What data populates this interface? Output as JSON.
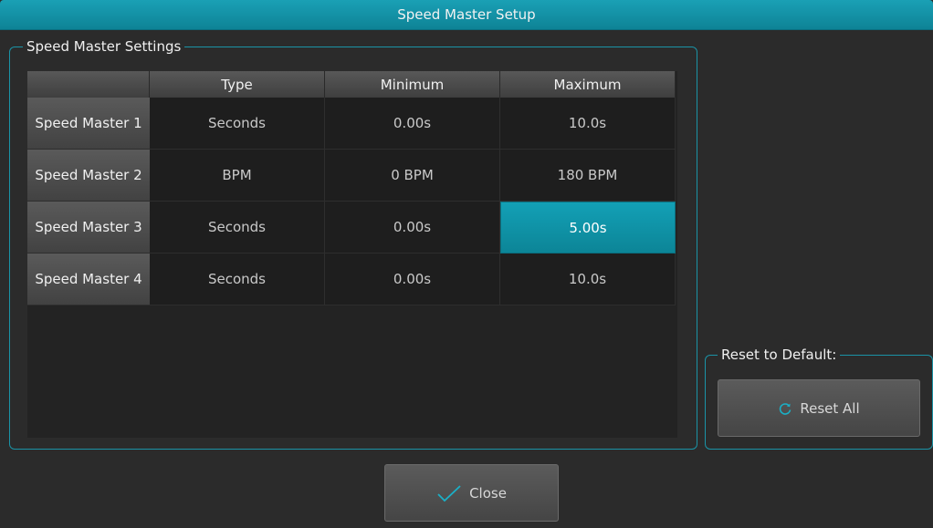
{
  "window": {
    "title": "Speed Master Setup"
  },
  "settings": {
    "legend": "Speed Master Settings",
    "columns": [
      "Type",
      "Minimum",
      "Maximum"
    ],
    "rows": [
      {
        "label": "Speed Master 1",
        "type": "Seconds",
        "minimum": "0.00s",
        "maximum": "10.0s"
      },
      {
        "label": "Speed Master 2",
        "type": "BPM",
        "minimum": "0 BPM",
        "maximum": "180 BPM"
      },
      {
        "label": "Speed Master 3",
        "type": "Seconds",
        "minimum": "0.00s",
        "maximum": "5.00s"
      },
      {
        "label": "Speed Master 4",
        "type": "Seconds",
        "minimum": "0.00s",
        "maximum": "10.0s"
      }
    ],
    "selected_cell": {
      "row": 3,
      "column": "Maximum"
    }
  },
  "reset": {
    "legend": "Reset to Default:",
    "button_label": "Reset All",
    "icon": "refresh-icon"
  },
  "footer": {
    "close_label": "Close",
    "close_icon": "checkmark-icon"
  },
  "colors": {
    "accent": "#1297ab",
    "background": "#2b2b2b",
    "table_background": "#232323"
  }
}
